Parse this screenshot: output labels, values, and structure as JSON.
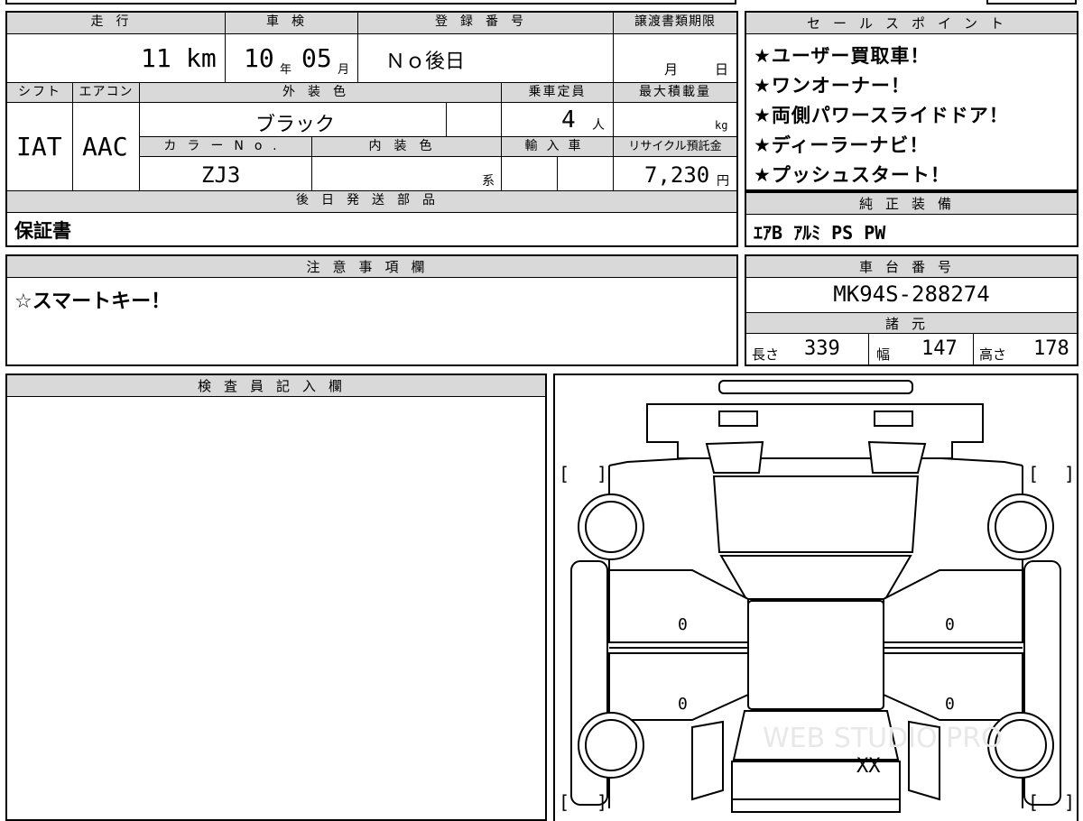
{
  "info": {
    "mileage_label": "走行",
    "mileage_value": "11",
    "mileage_unit": "km",
    "inspection_label": "車検",
    "inspection_year": "10",
    "inspection_year_unit": "年",
    "inspection_month": "05",
    "inspection_month_unit": "月",
    "reg_label": "登録番号",
    "reg_value": "Ｎｏ後日",
    "transfer_label": "譲渡書類期限",
    "transfer_month_unit": "月",
    "transfer_day_unit": "日",
    "shift_label": "シフト",
    "shift_value": "IAT",
    "ac_label": "エアコン",
    "ac_value": "AAC",
    "exterior_label": "外装色",
    "exterior_value": "ブラック",
    "capacity_label": "乗車定員",
    "capacity_value": "4",
    "capacity_unit": "人",
    "load_label": "最大積載量",
    "load_unit": "kg",
    "color_no_label": "カラーNo.",
    "color_no_value": "ZJ3",
    "interior_label": "内装色",
    "interior_unit": "系",
    "import_label": "輸入車",
    "recycle_label": "リサイクル預託金",
    "recycle_value": "7,230",
    "recycle_unit": "円",
    "later_parts_label": "後日発送部品",
    "later_parts_value": "保証書"
  },
  "sales": {
    "header": "セールスポイント",
    "points": [
      "★ユーザー買取車！",
      "★ワンオーナー！",
      "★両側パワースライドドア！",
      "★ディーラーナビ！",
      "★プッシュスタート！"
    ]
  },
  "equipment": {
    "header": "純正装備",
    "value": "ｴｱB ｱﾙﾐ PS PW"
  },
  "notes": {
    "header": "注意事項欄",
    "value": "☆スマートキー！"
  },
  "chassis": {
    "header": "車台番号",
    "value": "MK94S-288274"
  },
  "specs": {
    "header": "諸元",
    "length_label": "長さ",
    "length_value": "339",
    "width_label": "幅",
    "width_value": "147",
    "height_label": "高さ",
    "height_value": "178"
  },
  "inspector": {
    "header": "検査員記入欄"
  },
  "diagram": {
    "marks": [
      "0",
      "0",
      "0",
      "0",
      "XX"
    ],
    "watermark": "WEB STUDIO PRO",
    "bracket_left": "[",
    "bracket_right": "]"
  }
}
